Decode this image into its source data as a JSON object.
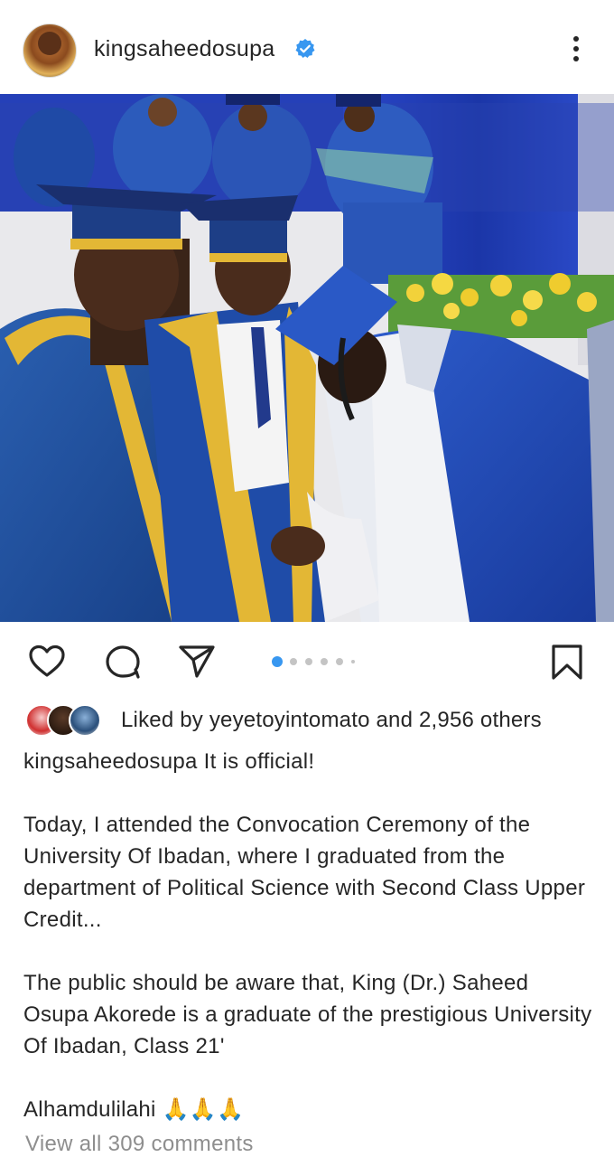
{
  "header": {
    "username": "kingsaheedosupa",
    "verified": true,
    "more_icon": "more-vertical-icon"
  },
  "photo": {
    "description_colors": {
      "stage_curtain": "#1f3db4",
      "gown_blue": "#1f4fa0",
      "gold_trim": "#e0b531",
      "graduate_gown": "#2450b8",
      "white_robe": "#f2f2f2",
      "flowers": "#f2d23a"
    }
  },
  "actions": {
    "like_icon": "heart-icon",
    "comment_icon": "comment-icon",
    "share_icon": "send-icon",
    "save_icon": "bookmark-icon",
    "carousel": {
      "count": 6,
      "active_index": 0,
      "active_color": "#3897f0",
      "inactive_color": "#c4c4c4"
    }
  },
  "likes": {
    "text": "Liked by yeyetoyintomato and 2,956 others"
  },
  "caption": {
    "username": "kingsaheedosupa",
    "line1": " It is official!",
    "para1": "Today, I attended the Convocation Ceremony of the University Of Ibadan, where I graduated from the department of Political Science with Second Class Upper Credit...",
    "para2": "The public should be aware that, King (Dr.) Saheed Osupa Akorede is a graduate of the prestigious University Of Ibadan, Class 21'",
    "para3": "Alhamdulilahi",
    "para3_emoji": "🙏🙏🙏"
  },
  "comments": {
    "view_all": "View all 309 comments"
  }
}
